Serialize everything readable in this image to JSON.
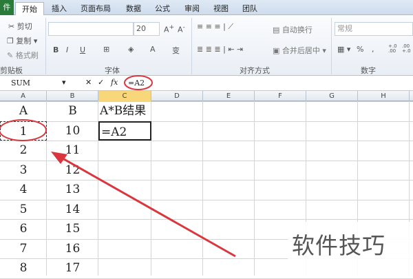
{
  "tabs": {
    "file": "件",
    "items": [
      "开始",
      "插入",
      "页面布局",
      "数据",
      "公式",
      "审阅",
      "视图",
      "团队"
    ]
  },
  "ribbon": {
    "clipboard": {
      "cut": "剪切",
      "copy": "复制",
      "format_painter": "格式刷",
      "group": "剪贴板"
    },
    "font": {
      "size": "20",
      "group": "字体",
      "bold": "B",
      "italic": "I",
      "underline": "U",
      "font_color": "A",
      "phonetic": "变"
    },
    "alignment": {
      "wrap": "自动换行",
      "merge": "合并后居中",
      "group": "对齐方式"
    },
    "number": {
      "format": "常规",
      "percent": "%",
      "comma": ",",
      "inc_decimal": "+.0 .00",
      "dec_decimal": ".00 +.0",
      "group": "数字"
    }
  },
  "formula_bar": {
    "name_box": "SUM",
    "cancel": "✕",
    "enter": "✓",
    "fx": "fx",
    "formula": "=A2"
  },
  "columns": [
    "A",
    "B",
    "C",
    "D",
    "E",
    "F",
    "G",
    "H"
  ],
  "selected_column": "C",
  "rows": [
    [
      "A",
      "B",
      "A*B结果"
    ],
    [
      "1",
      "10",
      "=A2"
    ],
    [
      "2",
      "11",
      ""
    ],
    [
      "3",
      "12",
      ""
    ],
    [
      "4",
      "13",
      ""
    ],
    [
      "5",
      "14",
      ""
    ],
    [
      "6",
      "15",
      ""
    ],
    [
      "7",
      "16",
      ""
    ],
    [
      "8",
      "17",
      ""
    ]
  ],
  "annotation_color": "#d9363e",
  "watermark": "软件技巧"
}
